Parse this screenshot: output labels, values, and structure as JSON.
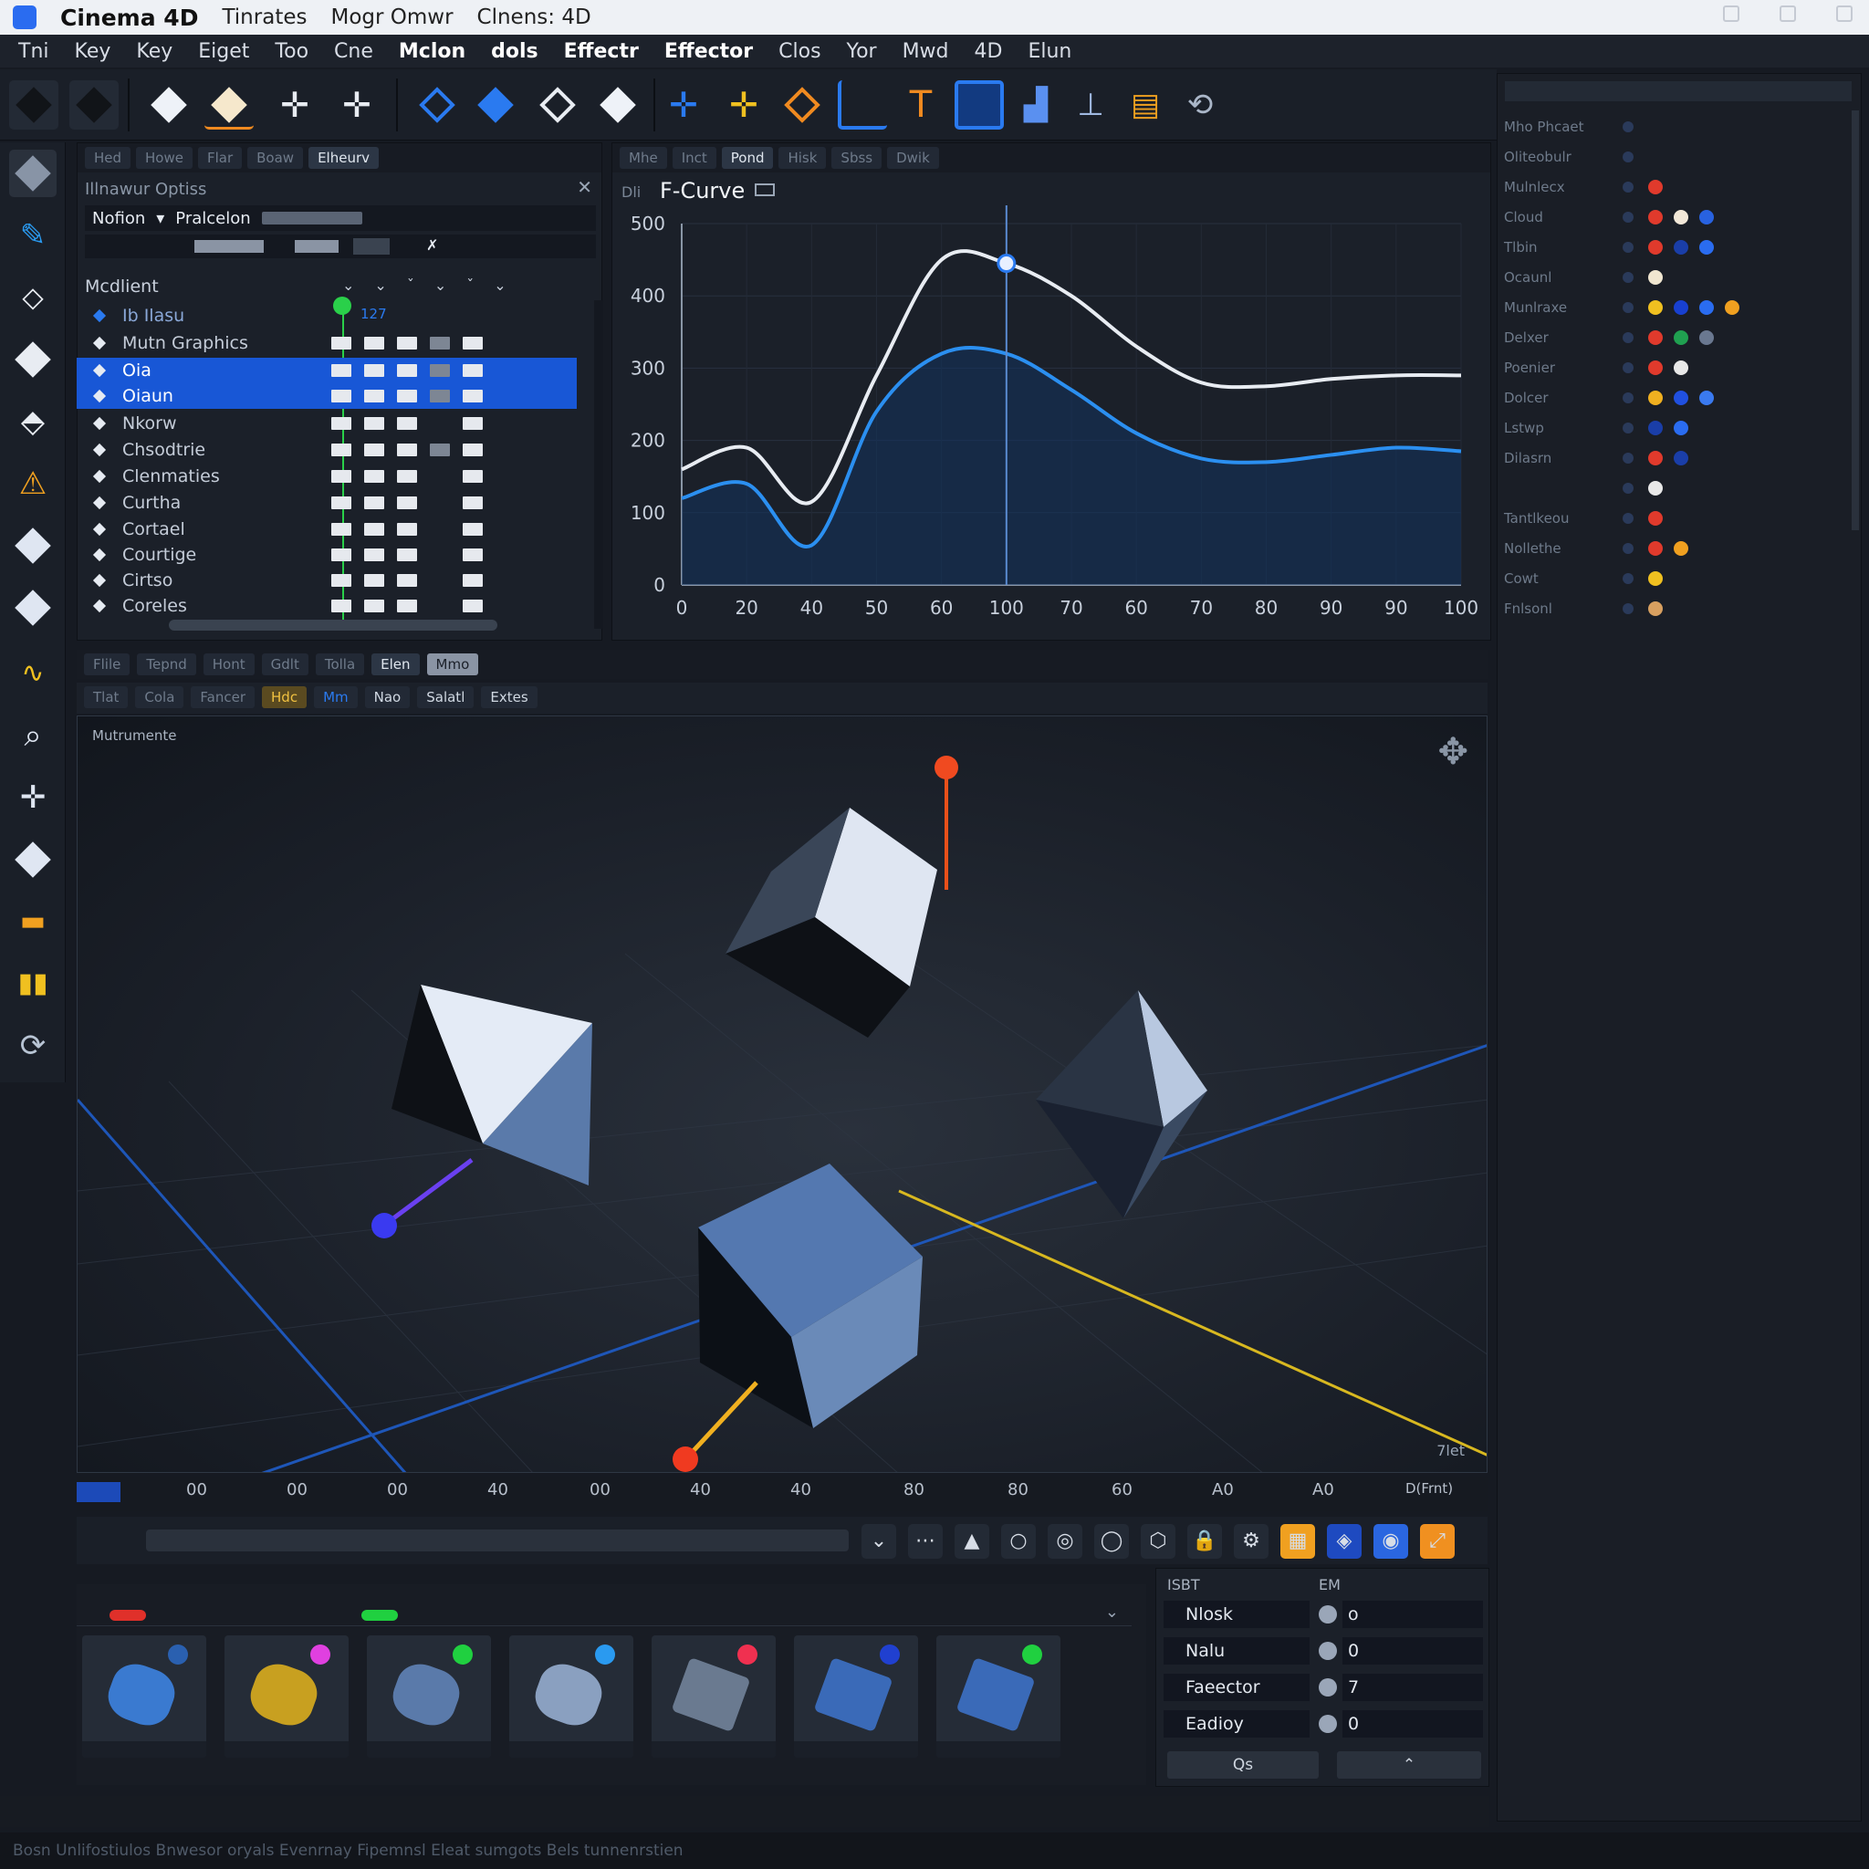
{
  "titlebar": {
    "app": "Cinema 4D",
    "items": [
      "Tinrates",
      "Mogr Omwr",
      "Clnens: 4D"
    ]
  },
  "menubar": {
    "items": [
      "Tni",
      "Key",
      "Key",
      "Eiget",
      "Too",
      "Cne",
      "Mclon",
      "dols",
      "Effectr",
      "Effector",
      "Clos",
      "Yor",
      "Mwd",
      "4D",
      "Elun"
    ]
  },
  "timeline_panel": {
    "tabs": [
      "Hed",
      "Howe",
      "Flar",
      "Boaw",
      "Elheurv"
    ],
    "header": "Illnawur Optiss",
    "motion_label": "Nofion",
    "mode_label": "Pralcelon",
    "column_header": "Mcdlient",
    "value_header": "127",
    "rows": [
      {
        "label": "Ib Ilasu",
        "selected": false
      },
      {
        "label": "Mutn Graphics",
        "selected": false
      },
      {
        "label": "Oia",
        "selected": true
      },
      {
        "label": "Oiaun",
        "selected": true
      },
      {
        "label": "Nkorw",
        "selected": false
      },
      {
        "label": "Chsodtrie",
        "selected": false
      },
      {
        "label": "Clenmaties",
        "selected": false
      },
      {
        "label": "Curtha",
        "selected": false
      },
      {
        "label": "Cortael",
        "selected": false
      },
      {
        "label": "Courtige",
        "selected": false
      },
      {
        "label": "Cirtso",
        "selected": false
      },
      {
        "label": "Coreles",
        "selected": false
      }
    ]
  },
  "fcurve_panel": {
    "tabs": [
      "Mhe",
      "Inct",
      "Pond",
      "Hisk",
      "Sbss",
      "Dwik"
    ],
    "prefix": "Dli",
    "title": "F-Curve"
  },
  "chart_data": {
    "type": "line",
    "title": "F-Curve",
    "x_tick_labels": [
      "0",
      "20",
      "40",
      "50",
      "60",
      "100",
      "70",
      "60",
      "70",
      "80",
      "90",
      "90",
      "100"
    ],
    "x": [
      0,
      1,
      2,
      3,
      4,
      5,
      6,
      7,
      8,
      9,
      10,
      11,
      12
    ],
    "ylim": [
      0,
      500
    ],
    "y_ticks": [
      0,
      100,
      200,
      300,
      400,
      500
    ],
    "grid": true,
    "series": [
      {
        "color": "#e8ecf2",
        "values": [
          160,
          190,
          115,
          290,
          450,
          445,
          400,
          330,
          280,
          275,
          285,
          290,
          290
        ]
      },
      {
        "color": "#2b8ff0",
        "values": [
          120,
          140,
          55,
          240,
          320,
          320,
          270,
          210,
          175,
          170,
          180,
          190,
          185
        ]
      }
    ],
    "playhead_x": 5
  },
  "viewport": {
    "tabs": [
      "Flile",
      "Tepnd",
      "Hont",
      "Gdlt",
      "Tolla",
      "Elen",
      "Mmo"
    ],
    "toolbar": [
      "Tlat",
      "Cola",
      "Fancer",
      "Hdc",
      "Mm",
      "Nao",
      "Salatl",
      "Extes"
    ],
    "label": "Mutrumente",
    "corner_label": "7let"
  },
  "right_panel": {
    "rows": [
      {
        "name": "Mho Phcaet",
        "colors": []
      },
      {
        "name": "Oliteobulr",
        "colors": []
      },
      {
        "name": "Mulnlecx",
        "colors": [
          "#e03a2c"
        ]
      },
      {
        "name": "Cloud",
        "colors": [
          "#e03a2c",
          "#f2e8d8",
          "#2862e0"
        ]
      },
      {
        "name": "Tlbin",
        "colors": [
          "#e03a2c",
          "#1a3ea8",
          "#2a6cf0"
        ]
      },
      {
        "name": "Ocaunl",
        "colors": [
          "#f0e6d0"
        ]
      },
      {
        "name": "Munlraxe",
        "colors": [
          "#f0c020",
          "#1840d0",
          "#2a6cf0",
          "#f0a020"
        ]
      },
      {
        "name": "Delxer",
        "colors": [
          "#e03a2c",
          "#20a050",
          "#6a7890"
        ]
      },
      {
        "name": "Poenier",
        "colors": [
          "#e03a2c",
          "#e8e8e8"
        ]
      },
      {
        "name": "Dolcer",
        "colors": [
          "#f0b020",
          "#2050e0",
          "#3a7af0"
        ]
      },
      {
        "name": "Lstwp",
        "colors": [
          "#1a3ea8",
          "#2a6cf0"
        ]
      },
      {
        "name": "Dilasrn",
        "colors": [
          "#e03a2c",
          "#1a3ea8"
        ]
      },
      {
        "name": "",
        "colors": [
          "#e8e8e8"
        ]
      },
      {
        "name": "Tantlkeou",
        "colors": [
          "#e03a2c"
        ]
      },
      {
        "name": "Nollethe",
        "colors": [
          "#e03a2c",
          "#f0a020"
        ]
      },
      {
        "name": "Cowt",
        "colors": [
          "#f0c020"
        ]
      },
      {
        "name": "Fnlsonl",
        "colors": [
          "#d8a060"
        ]
      }
    ]
  },
  "ruler": {
    "ticks": [
      "00",
      "00",
      "00",
      "40",
      "00",
      "40",
      "40",
      "80",
      "80",
      "60",
      "A0",
      "A0"
    ],
    "end_label": "D(Frnt)"
  },
  "transport": {
    "buttons": [
      "⌄",
      "⋯",
      "▲",
      "○",
      "◎",
      "◯",
      "⬡",
      "🔒",
      "⚙",
      "▦",
      "◈",
      "◉",
      "⤢"
    ]
  },
  "props": {
    "head_left": "ISBT",
    "head_right": "EM",
    "rows": [
      {
        "label": "Nlosk",
        "value": "o"
      },
      {
        "label": "Nalu",
        "value": "0"
      },
      {
        "label": "Faeector",
        "value": "7"
      },
      {
        "label": "Eadioy",
        "value": "0"
      }
    ],
    "btn_left": "Qs",
    "btn_right": "⌃"
  },
  "statusbar": {
    "text": "Bosn Unlifostiulos Bnwesor oryals Evenrnay Fipemnsl Eleat sumgots Bels tunnenrstien"
  }
}
